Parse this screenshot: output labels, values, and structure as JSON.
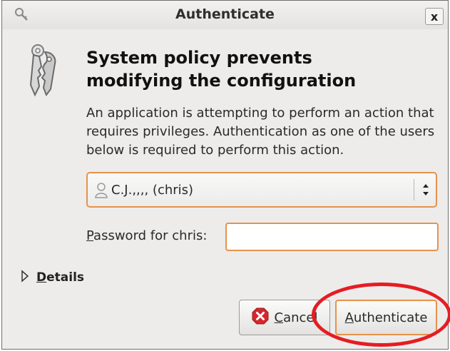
{
  "window": {
    "title": "Authenticate",
    "close_label": "x"
  },
  "heading": "System policy prevents modifying the configuration",
  "description": "An application is attempting to perform an action that requires privileges. Authentication as one of the users below is required to perform this action.",
  "user_select": {
    "selected": "C.J.,,,, (chris)"
  },
  "password": {
    "label_underlined": "P",
    "label_rest": "assword for chris:",
    "value": ""
  },
  "details": {
    "label_underlined": "D",
    "label_rest": "etails"
  },
  "buttons": {
    "cancel_underlined": "C",
    "cancel_rest": "ancel",
    "authenticate_underlined": "A",
    "authenticate_rest": "uthenticate"
  },
  "colors": {
    "focus_orange": "#e7924a",
    "annotation_red": "#e41d23",
    "dialog_bg": "#edeceb"
  },
  "icons": [
    "keys-titlebar-icon",
    "close-icon",
    "keys-icon",
    "user-icon",
    "select-arrows-icon",
    "expander-arrow-icon",
    "cancel-icon"
  ]
}
